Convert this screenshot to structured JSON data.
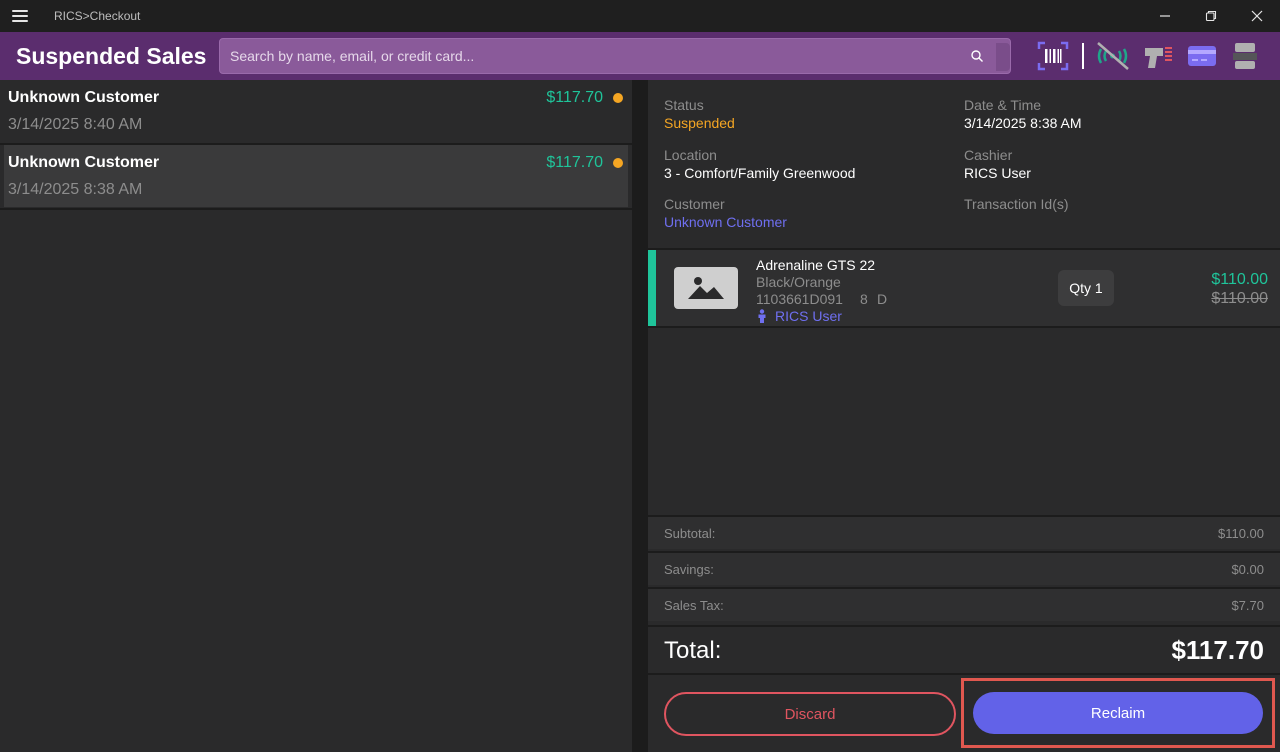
{
  "window": {
    "title": "RICS>Checkout"
  },
  "header": {
    "title": "Suspended Sales",
    "search_placeholder": "Search by name, email, or credit card..."
  },
  "sales": [
    {
      "customer": "Unknown Customer",
      "date": "3/14/2025 8:40 AM",
      "amount": "$117.70",
      "status_color": "#f5a623"
    },
    {
      "customer": "Unknown Customer",
      "date": "3/14/2025 8:38 AM",
      "amount": "$117.70",
      "status_color": "#f5a623"
    }
  ],
  "details": {
    "status_label": "Status",
    "status_value": "Suspended",
    "datetime_label": "Date & Time",
    "datetime_value": "3/14/2025 8:38 AM",
    "location_label": "Location",
    "location_value": "3 - Comfort/Family Greenwood",
    "cashier_label": "Cashier",
    "cashier_value": "RICS User",
    "customer_label": "Customer",
    "customer_value": "Unknown Customer",
    "transaction_label": "Transaction Id(s)"
  },
  "line_item": {
    "name": "Adrenaline GTS 22",
    "variant": "Black/Orange",
    "sku": "1103661D091",
    "size": "8",
    "width": "D",
    "salesperson": "RICS User",
    "qty": "Qty 1",
    "price": "$110.00",
    "original_price": "$110.00"
  },
  "totals": {
    "subtotal_label": "Subtotal:",
    "subtotal_value": "$110.00",
    "savings_label": "Savings:",
    "savings_value": "$0.00",
    "tax_label": "Sales Tax:",
    "tax_value": "$7.70",
    "total_label": "Total:",
    "total_value": "$117.70"
  },
  "actions": {
    "discard_label": "Discard",
    "reclaim_label": "Reclaim"
  },
  "colors": {
    "header_bg": "#5b2d6e",
    "accent_green": "#1fc49a",
    "accent_purple": "#6262e8",
    "warning": "#f5a623",
    "danger": "#e05560"
  }
}
